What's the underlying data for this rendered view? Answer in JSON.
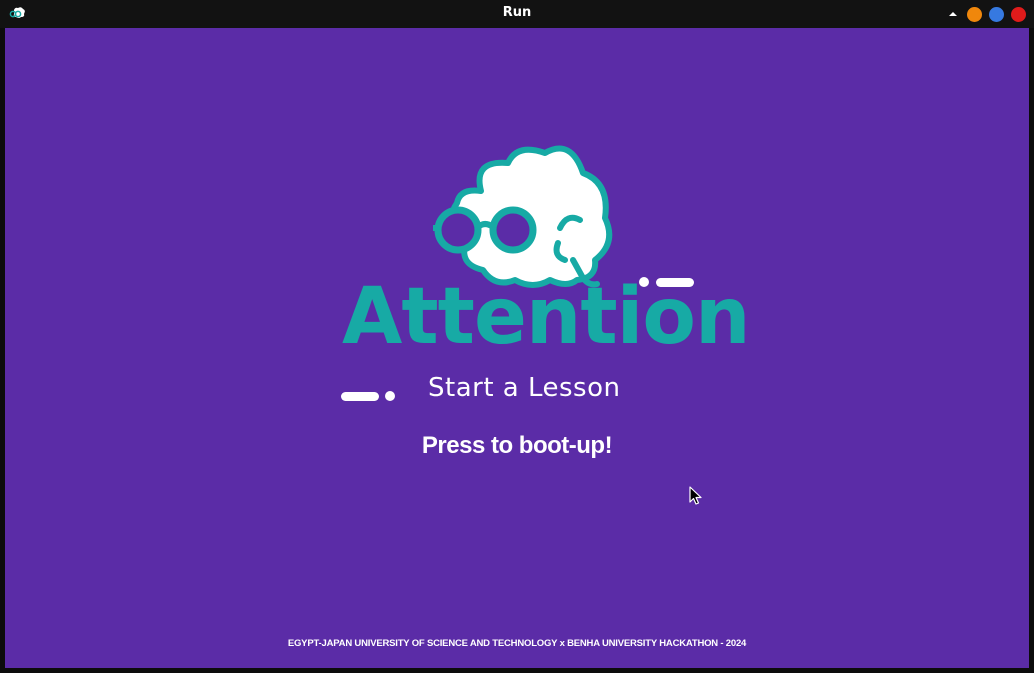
{
  "window": {
    "title": "Run",
    "app_icon": "brain-glasses-icon",
    "controls": [
      {
        "name": "scroll-up-icon",
        "color": "#ffffff"
      },
      {
        "name": "minimize-button",
        "color": "#f0870c"
      },
      {
        "name": "maximize-button",
        "color": "#3679e0"
      },
      {
        "name": "close-button",
        "color": "#e01b1b"
      }
    ]
  },
  "app": {
    "background_color": "#5b2ca7",
    "accent_color": "#17aaa5",
    "logo": {
      "icon": "brain-with-glasses-icon",
      "wordmark": "Attention",
      "subtitle": "Start a Lesson"
    },
    "boot_prompt": "Press to boot-up!",
    "footer": "EGYPT-JAPAN UNIVERSITY OF SCIENCE AND TECHNOLOGY x BENHA UNIVERSITY HACKATHON - 2024"
  }
}
